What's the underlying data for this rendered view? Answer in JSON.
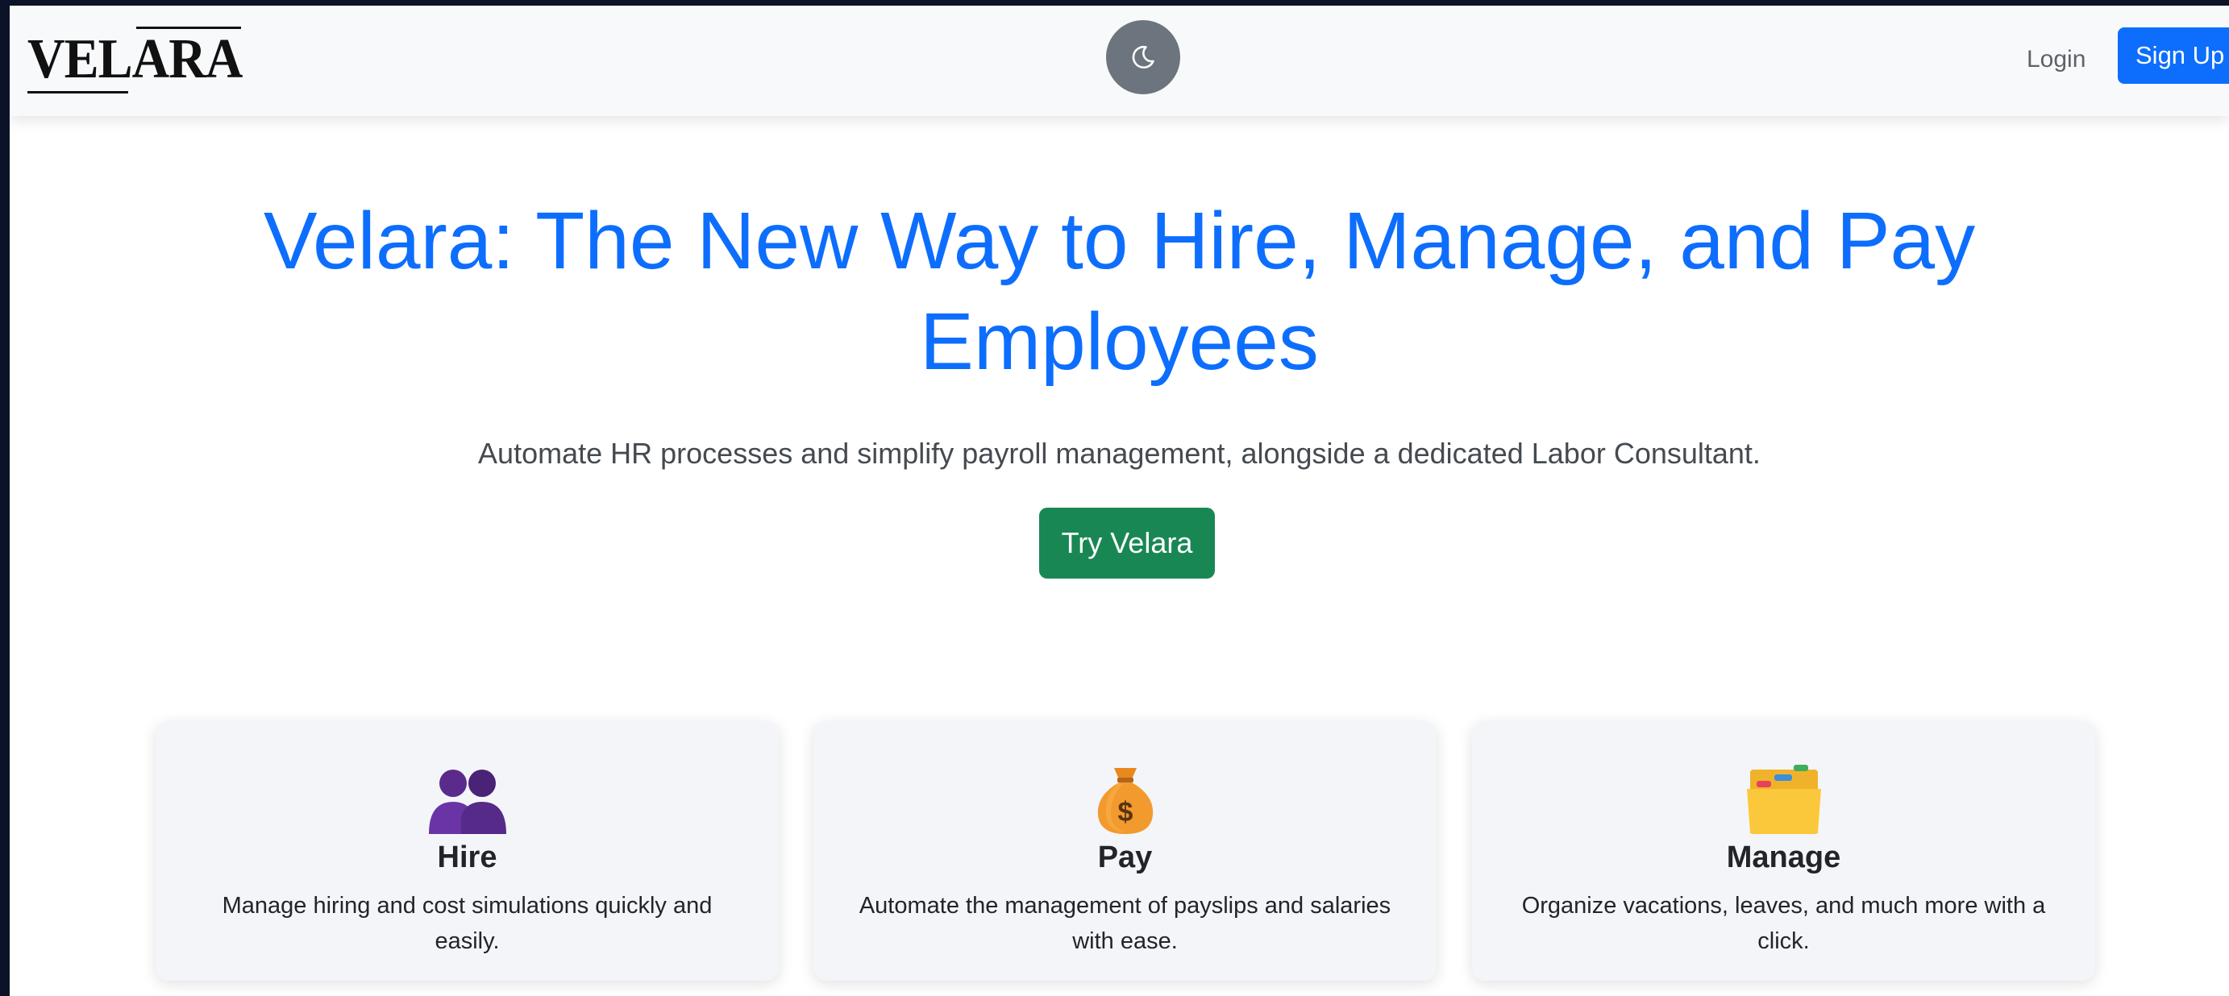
{
  "navbar": {
    "logo_text": "VELARA",
    "theme_toggle_icon": "moon-icon",
    "login_label": "Login",
    "signup_label": "Sign Up"
  },
  "hero": {
    "title_line1": "Velara: The New Way to Hire, Manage, and Pay",
    "title_line2": "Employees",
    "subtitle": "Automate HR processes and simplify payroll management, alongside a dedicated Labor Consultant.",
    "cta_label": "Try Velara"
  },
  "features": [
    {
      "icon": "people-icon",
      "title": "Hire",
      "description": "Manage hiring and cost simulations quickly and easily."
    },
    {
      "icon": "money-bag-icon",
      "title": "Pay",
      "description": "Automate the management of payslips and salaries with ease."
    },
    {
      "icon": "folder-icon",
      "title": "Manage",
      "description": "Organize vacations, leaves, and much more with a click."
    }
  ],
  "colors": {
    "primary": "#0d6efd",
    "success": "#198754",
    "secondary": "#6c757d",
    "navbar_bg": "#f8f9fa",
    "outer_bg": "#0c1328"
  }
}
